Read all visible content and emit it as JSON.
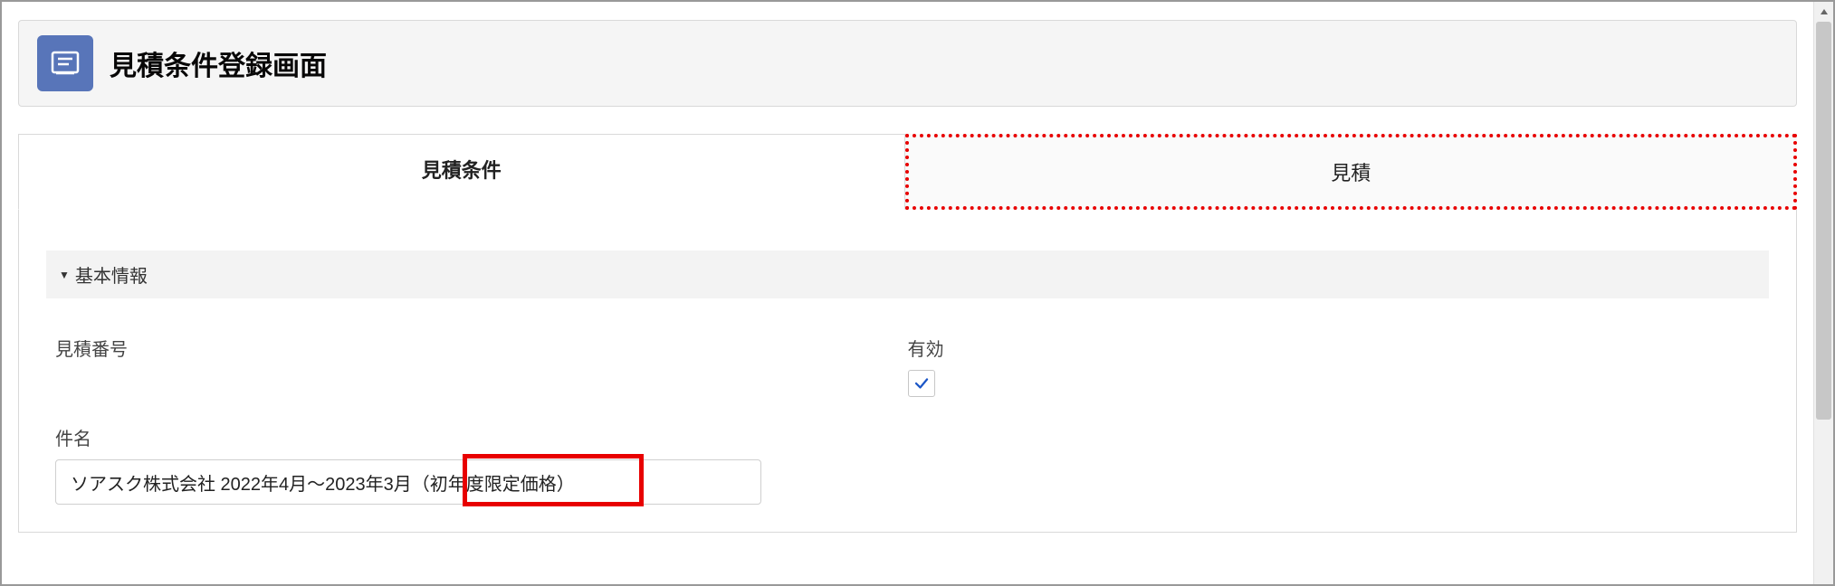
{
  "header": {
    "title": "見積条件登録画面"
  },
  "tabs": {
    "conditions_label": "見積条件",
    "quote_label": "見積"
  },
  "section": {
    "basic_info": "基本情報"
  },
  "fields": {
    "quote_number_label": "見積番号",
    "valid_label": "有効",
    "valid_checked": true,
    "subject_label": "件名",
    "subject_value": "ソアスク株式会社 2022年4月～2023年3月（初年度限定価格）"
  }
}
